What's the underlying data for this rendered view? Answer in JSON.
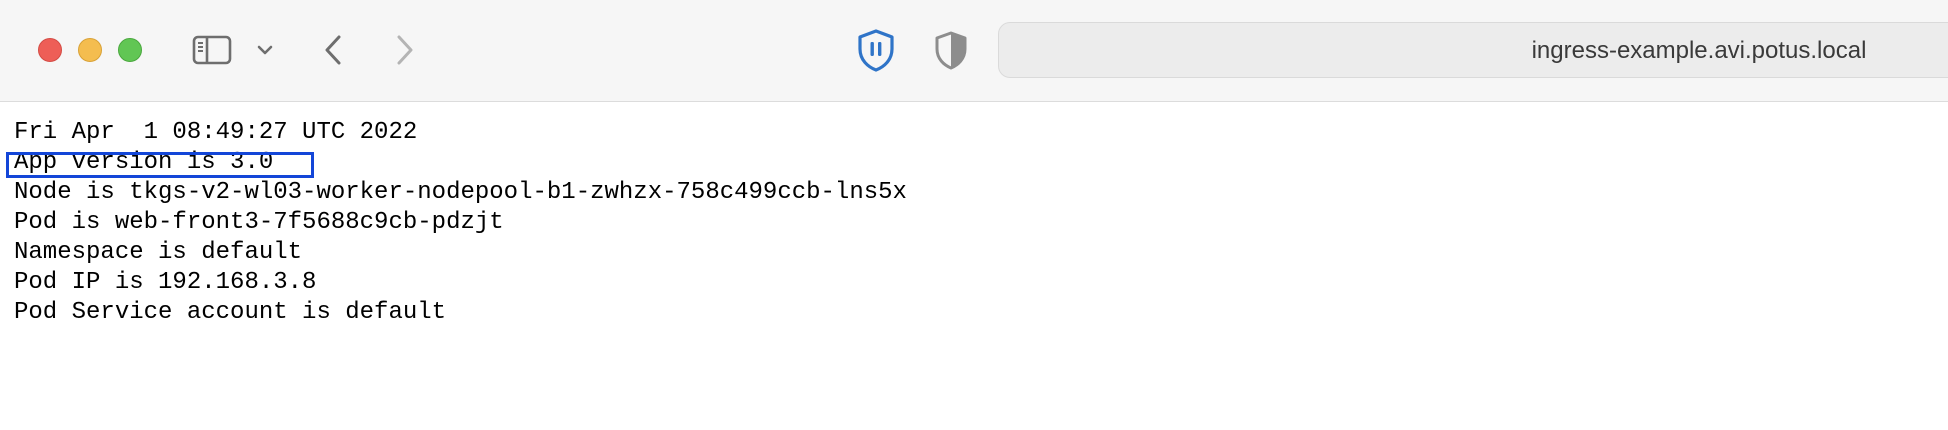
{
  "browser": {
    "address": "ingress-example.avi.potus.local",
    "icons": {
      "sidebar": "sidebar-icon",
      "chevron": "chevron-down-icon",
      "back": "chevron-left-icon",
      "forward": "chevron-right-icon",
      "extension": "shield-pause-icon",
      "privacy": "privacy-shield-icon"
    },
    "colors": {
      "close": "#ee5e57",
      "minimize": "#f4bd4f",
      "maximize": "#61c654",
      "extension_blue": "#2f74c8",
      "highlight": "#1346d8"
    }
  },
  "page": {
    "lines": [
      "Fri Apr  1 08:49:27 UTC 2022",
      "App version is 3.0",
      "Node is tkgs-v2-wl03-worker-nodepool-b1-zwhzx-758c499ccb-lns5x",
      "Pod is web-front3-7f5688c9cb-pdzjt",
      "Namespace is default",
      "Pod IP is 192.168.3.8",
      "Pod Service account is default"
    ]
  }
}
